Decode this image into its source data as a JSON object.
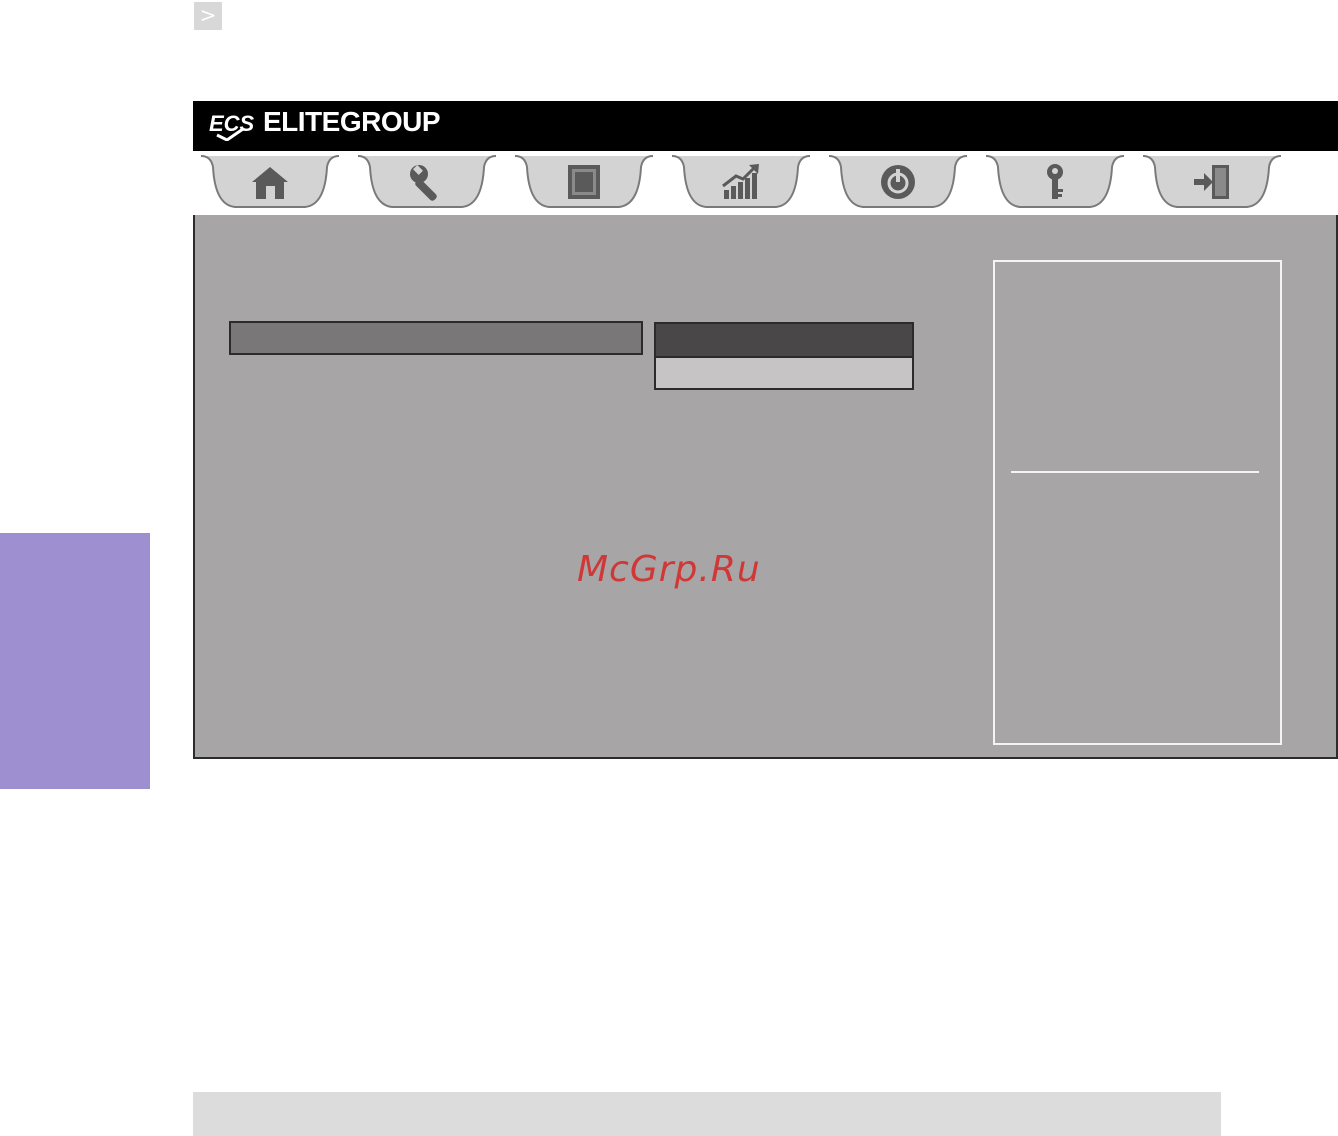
{
  "page": {
    "nav_arrow": ">",
    "watermark": "McGrp.Ru"
  },
  "bios": {
    "brand_logo": "ECS",
    "brand_name": "ELITEGROUP",
    "tabs": [
      {
        "id": "main",
        "icon": "home-icon",
        "active": true
      },
      {
        "id": "advanced",
        "icon": "wrench-icon",
        "active": false
      },
      {
        "id": "chipset",
        "icon": "chip-icon",
        "active": false
      },
      {
        "id": "mib",
        "icon": "chart-icon",
        "active": false
      },
      {
        "id": "boot",
        "icon": "power-icon",
        "active": false
      },
      {
        "id": "security",
        "icon": "key-icon",
        "active": false
      },
      {
        "id": "exit",
        "icon": "exit-icon",
        "active": false
      }
    ]
  },
  "colors": {
    "panel": "#a7a5a6",
    "side_tab": "#9d8fd0",
    "header": "#000000",
    "watermark": "#d03737"
  }
}
